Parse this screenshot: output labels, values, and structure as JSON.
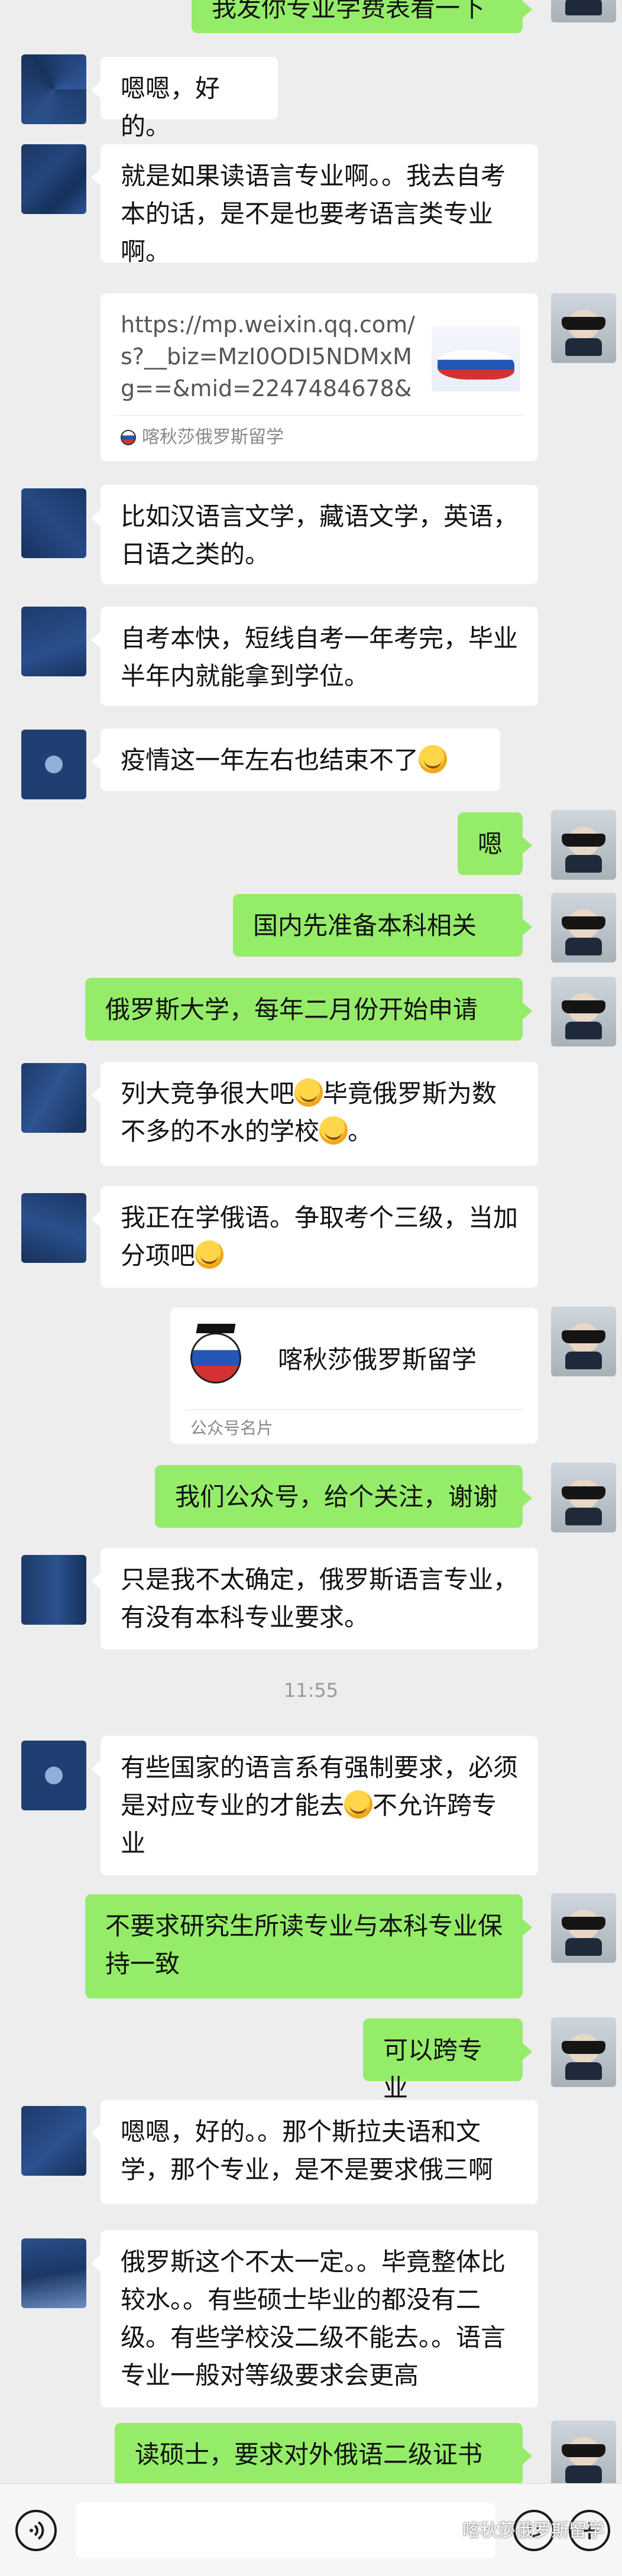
{
  "messages": {
    "m0": "我发你专业学费表看一下",
    "m1": "嗯嗯，好的。",
    "m2": "就是如果读语言专业啊。。我去自考本的话，是不是也要考语言类专业啊。",
    "link": {
      "url": "https://mp.weixin.qq.com/s?__biz=MzI0ODI5NDMxMg==&mid=2247484678&idx...",
      "source": "喀秋莎俄罗斯留学"
    },
    "m3": "比如汉语言文学，藏语文学，英语，日语之类的。",
    "m4": "自考本快，短线自考一年考完，毕业半年内就能拿到学位。",
    "m5": "疫情这一年左右也结束不了",
    "m6": "嗯",
    "m7": "国内先准备本科相关",
    "m8": "俄罗斯大学，每年二月份开始申请",
    "m9a": "列大竞争很大吧",
    "m9b": "毕竟俄罗斯为数不多的不水的学校",
    "m9c": "。",
    "m10a": "我正在学俄语。争取考个三级，当加分项吧",
    "card": {
      "name": "喀秋莎俄罗斯留学",
      "label": "公众号名片"
    },
    "m11": "我们公众号，给个关注，谢谢",
    "m12": "只是我不太确定，俄罗斯语言专业，有没有本科专业要求。",
    "time": "11:55",
    "m13a": "有些国家的语言系有强制要求，必须是对应专业的才能去",
    "m13b": "不允许跨专业",
    "m14": "不要求研究生所读专业与本科专业保持一致",
    "m15": "可以跨专业",
    "m16": "嗯嗯，好的。。那个斯拉夫语和文学，那个专业，是不是要求俄三啊",
    "m17": "俄罗斯这个不太一定。。毕竟整体比较水。。有些硕士毕业的都没有二级。有些学校没二级不能去。。语言专业一般对等级要求会更高",
    "m18": "读硕士，要求对外俄语二级证书"
  },
  "watermark": "喀秋莎俄罗斯留学",
  "icons": {
    "voice": "voice-icon",
    "emoji": "emoji-icon",
    "plus": "plus-icon"
  },
  "colors": {
    "background": "#ededed",
    "outgoing_bubble": "#95ec69",
    "incoming_bubble": "#ffffff"
  }
}
